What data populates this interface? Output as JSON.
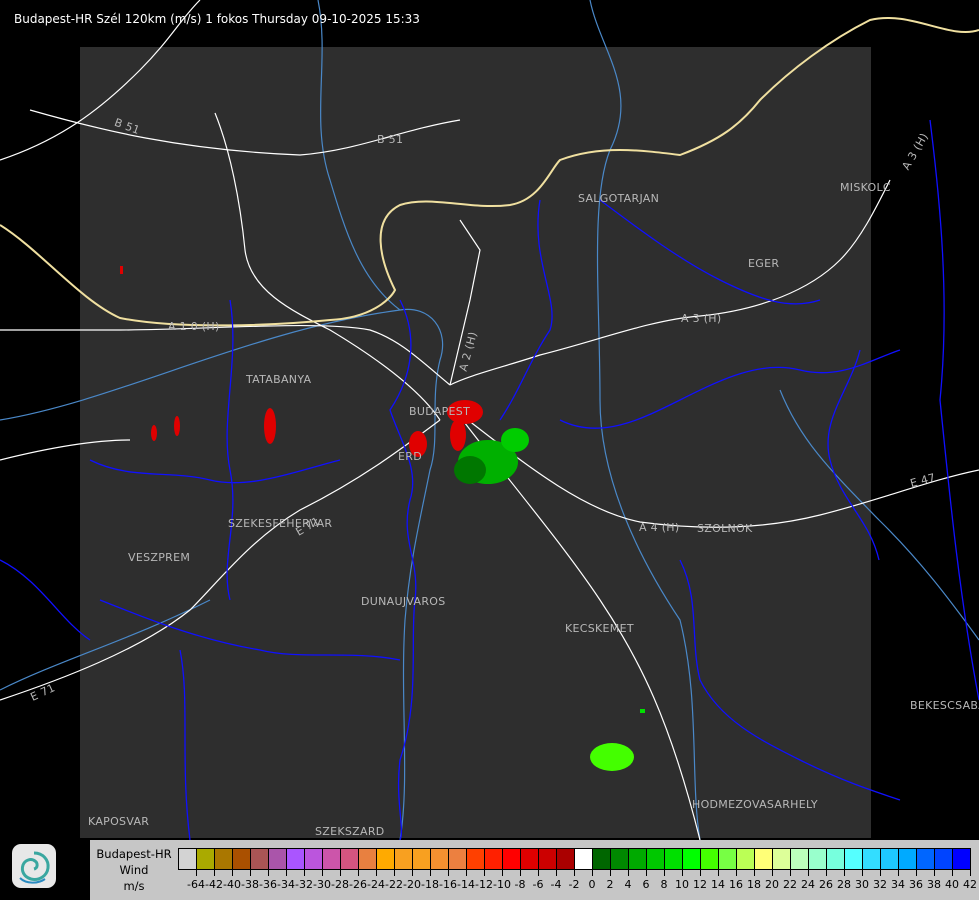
{
  "title": "Budapest-HR Szél 120km (m/s) 1 fokos Thursday 09-10-2025 15:33",
  "legend": {
    "line1": "Budapest-HR",
    "line2": "Wind",
    "line3": "m/s",
    "colors": [
      "#d3d3d3",
      "#aaaa00",
      "#aa7700",
      "#aa5000",
      "#aa5555",
      "#aa55aa",
      "#aa55ff",
      "#bb55dd",
      "#cc55aa",
      "#d45580",
      "#e88040",
      "#ffaa00",
      "#f8a020",
      "#f8a020",
      "#f59030",
      "#ec8040",
      "#ff4000",
      "#ff2000",
      "#ff0000",
      "#e00000",
      "#cc0000",
      "#aa0000",
      "#ffffff",
      "#006600",
      "#008800",
      "#00aa00",
      "#00c800",
      "#00e000",
      "#00ff00",
      "#44ff00",
      "#77ff44",
      "#bbff55",
      "#ffff77",
      "#ddff99",
      "#bbffbb",
      "#99ffcc",
      "#77ffdd",
      "#55ffff",
      "#33ddff",
      "#1ec8ff",
      "#00aaff",
      "#0066ff",
      "#0044ff",
      "#0000ff"
    ],
    "ticks": [
      "-64",
      "-42",
      "-40",
      "-38",
      "-36",
      "-34",
      "-32",
      "-30",
      "-28",
      "-26",
      "-24",
      "-22",
      "-20",
      "-18",
      "-16",
      "-14",
      "-12",
      "-10",
      "-8",
      "-6",
      "-4",
      "-2",
      "0",
      "2",
      "4",
      "6",
      "8",
      "10",
      "12",
      "14",
      "16",
      "18",
      "20",
      "22",
      "24",
      "26",
      "28",
      "30",
      "32",
      "34",
      "36",
      "38",
      "40",
      "42"
    ]
  },
  "cities": {
    "tatabanya": "TATABANYA",
    "budapest": "BUDAPEST",
    "erd": "ERD",
    "szekesfehervar": "SZEKESFEHERVAR",
    "veszprem": "VESZPREM",
    "dunaujvaros": "DUNAUJVAROS",
    "kecskemet": "KECSKEMET",
    "salgotarjan": "SALGOTARJAN",
    "eger": "EGER",
    "miskolc": "MISKOLC",
    "szolnok": "SZOLNOK",
    "bekescsaba": "BEKESCSABA",
    "hodmezovasarhely": "HODMEZOVASARHELY",
    "kaposvar": "KAPOSVAR",
    "szekszard": "SZEKSZARD"
  },
  "roads": {
    "b51_west": "B 51",
    "b51_east": "B 51",
    "a10": "A 1 0 (H)",
    "a2": "A 2 (H)",
    "a3": "A 3 (H)",
    "a3_ne": "A 3 (H)",
    "a4": "A 4 (H)",
    "e47": "E 47",
    "e71": "E 71",
    "e71_sw": "E 71"
  },
  "colors": {
    "radar_area": "#2e2e2e",
    "border": "#0000ff",
    "river": "#4a88c8",
    "road": "#ffffff",
    "legend_bg": "#c6c6c6"
  }
}
